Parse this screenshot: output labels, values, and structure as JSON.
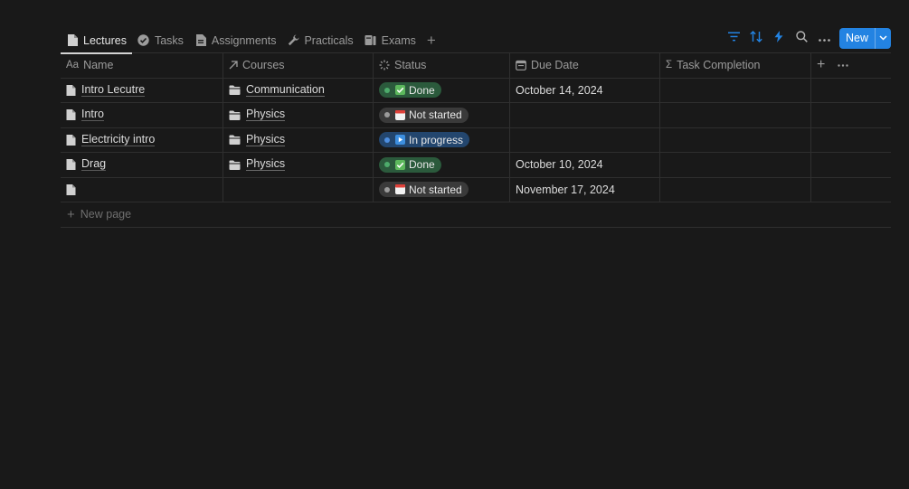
{
  "tabs": [
    {
      "label": "Lectures",
      "icon": "document-icon",
      "active": true
    },
    {
      "label": "Tasks",
      "icon": "check-circle-icon",
      "active": false
    },
    {
      "label": "Assignments",
      "icon": "assignment-doc-icon",
      "active": false
    },
    {
      "label": "Practicals",
      "icon": "wrench-icon",
      "active": false
    },
    {
      "label": "Exams",
      "icon": "book-icon",
      "active": false
    }
  ],
  "toolbar": {
    "new_label": "New",
    "accent": "#2383e2",
    "icons": [
      "filter-icon",
      "sort-icon",
      "lightning-icon",
      "search-icon",
      "more-icon"
    ]
  },
  "columns": {
    "name": "Name",
    "name_prefix": "Aa",
    "courses": "Courses",
    "status": "Status",
    "due": "Due Date",
    "task": "Task Completion",
    "task_prefix": "Σ"
  },
  "rows": [
    {
      "name": "Intro Lecutre",
      "course": "Communication",
      "status": "Done",
      "status_kind": "done",
      "due": "October 14, 2024"
    },
    {
      "name": "Intro",
      "course": "Physics",
      "status": "Not started",
      "status_kind": "notstarted",
      "due": ""
    },
    {
      "name": "Electricity intro",
      "course": "Physics",
      "status": "In progress",
      "status_kind": "inprogress",
      "due": ""
    },
    {
      "name": "Drag",
      "course": "Physics",
      "status": "Done",
      "status_kind": "done",
      "due": "October 10, 2024"
    },
    {
      "name": "",
      "course": "",
      "status": "Not started",
      "status_kind": "notstarted",
      "due": "November 17, 2024"
    }
  ],
  "new_page_label": "New page",
  "status_colors": {
    "done": "#2b5a3c",
    "notstarted": "#3a3a3a",
    "inprogress": "#23466e"
  }
}
